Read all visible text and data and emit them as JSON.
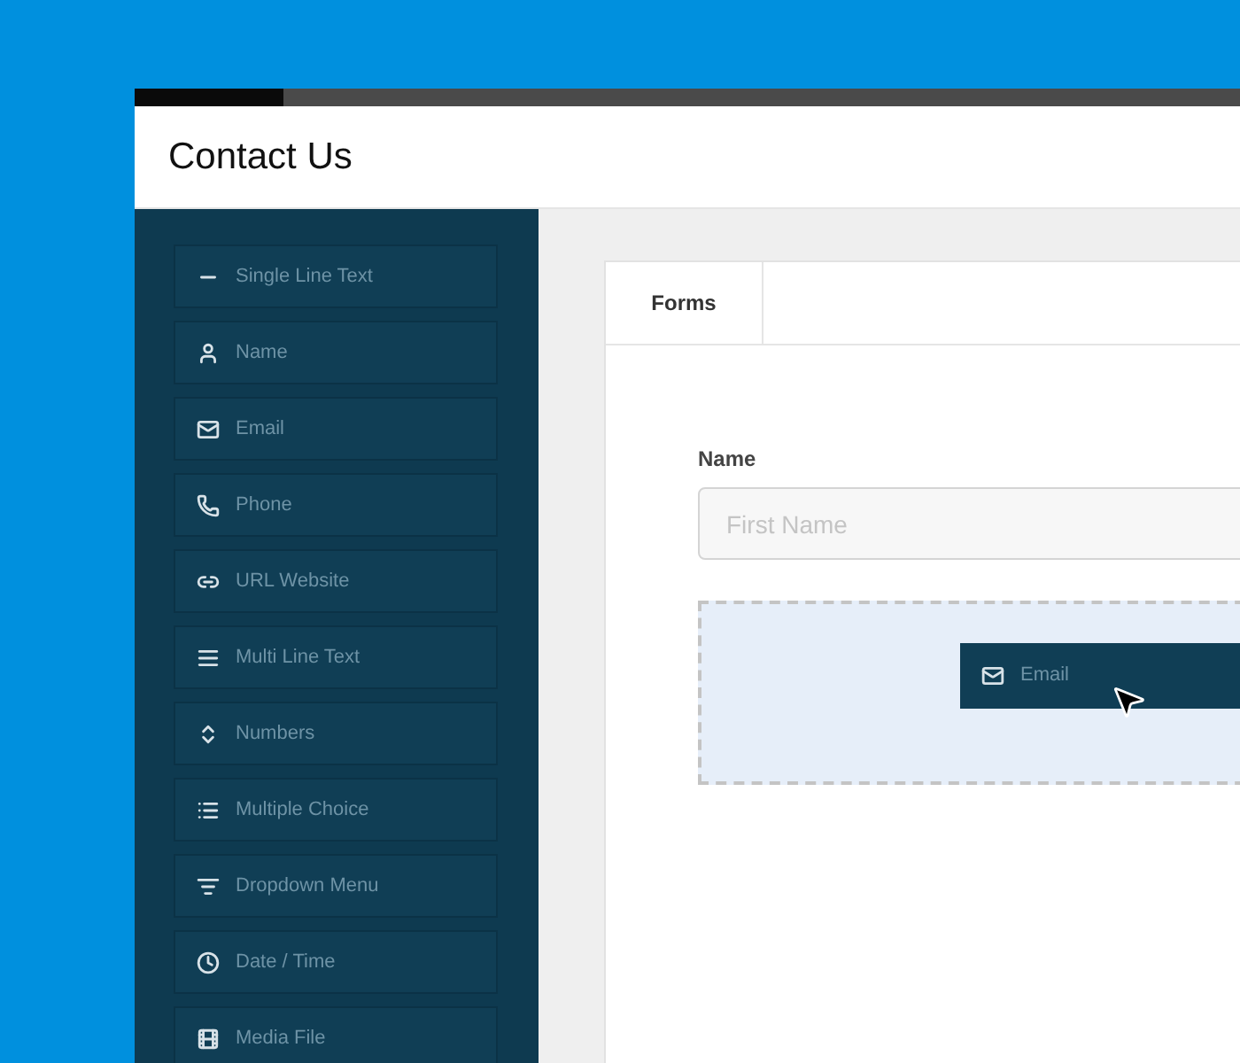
{
  "window": {
    "title": "Contact Us"
  },
  "sidebar": {
    "items": [
      {
        "label": "Single Line Text"
      },
      {
        "label": "Name"
      },
      {
        "label": "Email"
      },
      {
        "label": "Phone"
      },
      {
        "label": "URL Website"
      },
      {
        "label": "Multi Line Text"
      },
      {
        "label": "Numbers"
      },
      {
        "label": "Multiple Choice"
      },
      {
        "label": "Dropdown Menu"
      },
      {
        "label": "Date / Time"
      },
      {
        "label": "Media File"
      }
    ]
  },
  "tabs": [
    {
      "label": "Forms",
      "selected": true
    }
  ],
  "form": {
    "field_label": "Name",
    "placeholder": "First Name",
    "dragged_item": {
      "label": "Email"
    }
  }
}
